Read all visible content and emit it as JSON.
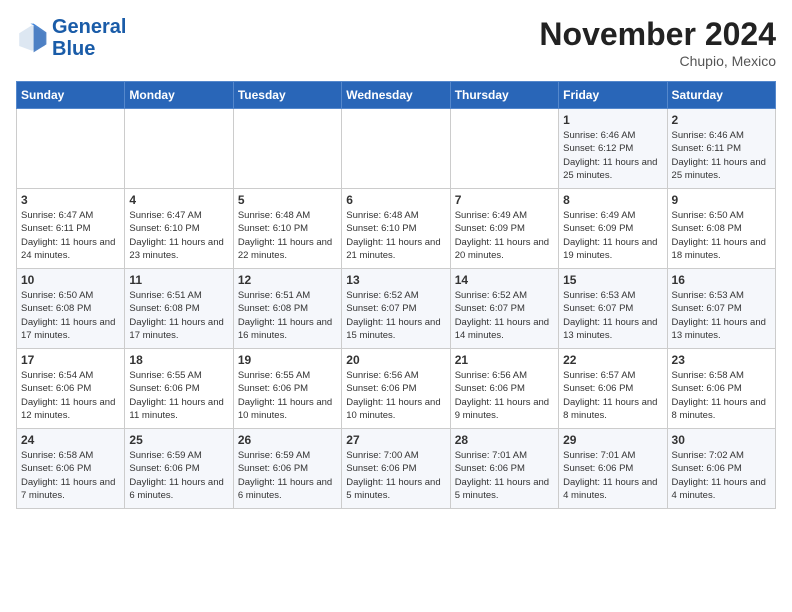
{
  "header": {
    "logo_line1": "General",
    "logo_line2": "Blue",
    "month": "November 2024",
    "location": "Chupio, Mexico"
  },
  "weekdays": [
    "Sunday",
    "Monday",
    "Tuesday",
    "Wednesday",
    "Thursday",
    "Friday",
    "Saturday"
  ],
  "weeks": [
    [
      {
        "day": "",
        "info": ""
      },
      {
        "day": "",
        "info": ""
      },
      {
        "day": "",
        "info": ""
      },
      {
        "day": "",
        "info": ""
      },
      {
        "day": "",
        "info": ""
      },
      {
        "day": "1",
        "info": "Sunrise: 6:46 AM\nSunset: 6:12 PM\nDaylight: 11 hours and 25 minutes."
      },
      {
        "day": "2",
        "info": "Sunrise: 6:46 AM\nSunset: 6:11 PM\nDaylight: 11 hours and 25 minutes."
      }
    ],
    [
      {
        "day": "3",
        "info": "Sunrise: 6:47 AM\nSunset: 6:11 PM\nDaylight: 11 hours and 24 minutes."
      },
      {
        "day": "4",
        "info": "Sunrise: 6:47 AM\nSunset: 6:10 PM\nDaylight: 11 hours and 23 minutes."
      },
      {
        "day": "5",
        "info": "Sunrise: 6:48 AM\nSunset: 6:10 PM\nDaylight: 11 hours and 22 minutes."
      },
      {
        "day": "6",
        "info": "Sunrise: 6:48 AM\nSunset: 6:10 PM\nDaylight: 11 hours and 21 minutes."
      },
      {
        "day": "7",
        "info": "Sunrise: 6:49 AM\nSunset: 6:09 PM\nDaylight: 11 hours and 20 minutes."
      },
      {
        "day": "8",
        "info": "Sunrise: 6:49 AM\nSunset: 6:09 PM\nDaylight: 11 hours and 19 minutes."
      },
      {
        "day": "9",
        "info": "Sunrise: 6:50 AM\nSunset: 6:08 PM\nDaylight: 11 hours and 18 minutes."
      }
    ],
    [
      {
        "day": "10",
        "info": "Sunrise: 6:50 AM\nSunset: 6:08 PM\nDaylight: 11 hours and 17 minutes."
      },
      {
        "day": "11",
        "info": "Sunrise: 6:51 AM\nSunset: 6:08 PM\nDaylight: 11 hours and 17 minutes."
      },
      {
        "day": "12",
        "info": "Sunrise: 6:51 AM\nSunset: 6:08 PM\nDaylight: 11 hours and 16 minutes."
      },
      {
        "day": "13",
        "info": "Sunrise: 6:52 AM\nSunset: 6:07 PM\nDaylight: 11 hours and 15 minutes."
      },
      {
        "day": "14",
        "info": "Sunrise: 6:52 AM\nSunset: 6:07 PM\nDaylight: 11 hours and 14 minutes."
      },
      {
        "day": "15",
        "info": "Sunrise: 6:53 AM\nSunset: 6:07 PM\nDaylight: 11 hours and 13 minutes."
      },
      {
        "day": "16",
        "info": "Sunrise: 6:53 AM\nSunset: 6:07 PM\nDaylight: 11 hours and 13 minutes."
      }
    ],
    [
      {
        "day": "17",
        "info": "Sunrise: 6:54 AM\nSunset: 6:06 PM\nDaylight: 11 hours and 12 minutes."
      },
      {
        "day": "18",
        "info": "Sunrise: 6:55 AM\nSunset: 6:06 PM\nDaylight: 11 hours and 11 minutes."
      },
      {
        "day": "19",
        "info": "Sunrise: 6:55 AM\nSunset: 6:06 PM\nDaylight: 11 hours and 10 minutes."
      },
      {
        "day": "20",
        "info": "Sunrise: 6:56 AM\nSunset: 6:06 PM\nDaylight: 11 hours and 10 minutes."
      },
      {
        "day": "21",
        "info": "Sunrise: 6:56 AM\nSunset: 6:06 PM\nDaylight: 11 hours and 9 minutes."
      },
      {
        "day": "22",
        "info": "Sunrise: 6:57 AM\nSunset: 6:06 PM\nDaylight: 11 hours and 8 minutes."
      },
      {
        "day": "23",
        "info": "Sunrise: 6:58 AM\nSunset: 6:06 PM\nDaylight: 11 hours and 8 minutes."
      }
    ],
    [
      {
        "day": "24",
        "info": "Sunrise: 6:58 AM\nSunset: 6:06 PM\nDaylight: 11 hours and 7 minutes."
      },
      {
        "day": "25",
        "info": "Sunrise: 6:59 AM\nSunset: 6:06 PM\nDaylight: 11 hours and 6 minutes."
      },
      {
        "day": "26",
        "info": "Sunrise: 6:59 AM\nSunset: 6:06 PM\nDaylight: 11 hours and 6 minutes."
      },
      {
        "day": "27",
        "info": "Sunrise: 7:00 AM\nSunset: 6:06 PM\nDaylight: 11 hours and 5 minutes."
      },
      {
        "day": "28",
        "info": "Sunrise: 7:01 AM\nSunset: 6:06 PM\nDaylight: 11 hours and 5 minutes."
      },
      {
        "day": "29",
        "info": "Sunrise: 7:01 AM\nSunset: 6:06 PM\nDaylight: 11 hours and 4 minutes."
      },
      {
        "day": "30",
        "info": "Sunrise: 7:02 AM\nSunset: 6:06 PM\nDaylight: 11 hours and 4 minutes."
      }
    ]
  ]
}
